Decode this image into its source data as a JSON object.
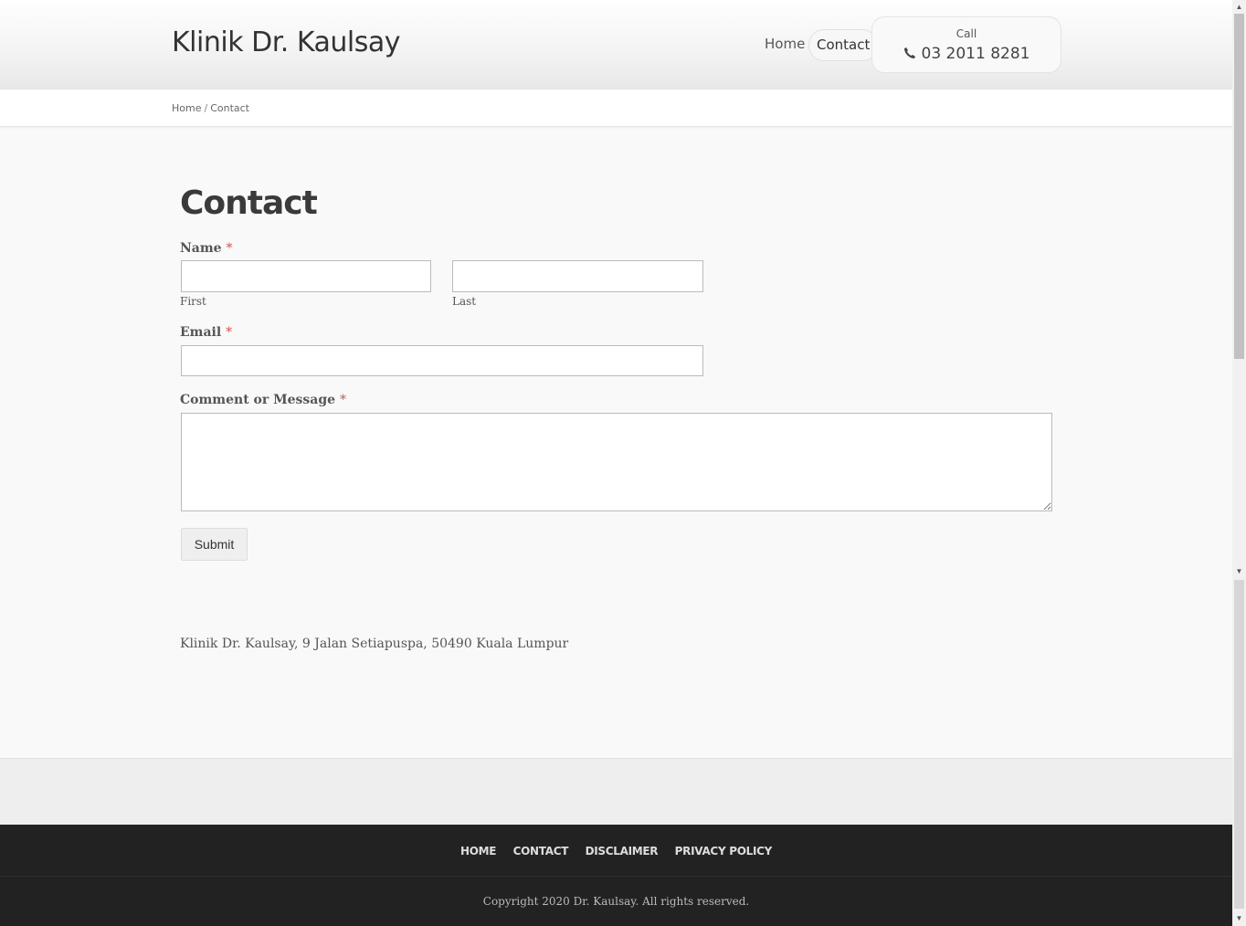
{
  "header": {
    "site_title": "Klinik Dr. Kaulsay",
    "nav": [
      {
        "label": "Home"
      },
      {
        "label": "Contact"
      }
    ],
    "call": {
      "label": "Call",
      "number": "03 2011 8281"
    }
  },
  "breadcrumb": {
    "home": "Home",
    "separator": "/",
    "current": "Contact"
  },
  "main": {
    "title": "Contact",
    "form": {
      "name_label": "Name",
      "required_mark": "*",
      "first_label": "First",
      "last_label": "Last",
      "first_value": "",
      "last_value": "",
      "email_label": "Email",
      "email_value": "",
      "message_label": "Comment or Message",
      "message_value": "",
      "submit_label": "Submit"
    },
    "address": "Klinik Dr. Kaulsay, 9 Jalan Setiapuspa, 50490 Kuala Lumpur"
  },
  "footer": {
    "menu": [
      {
        "label": "HOME"
      },
      {
        "label": "CONTACT"
      },
      {
        "label": "DISCLAIMER"
      },
      {
        "label": "PRIVACY POLICY"
      }
    ],
    "copyright": "Copyright 2020 Dr. Kaulsay. All rights reserved."
  },
  "colors": {
    "required": "#d9534f",
    "footer_bg": "#222222",
    "page_bg": "#f9f9f9"
  },
  "icons": {
    "phone": "phone-icon"
  }
}
